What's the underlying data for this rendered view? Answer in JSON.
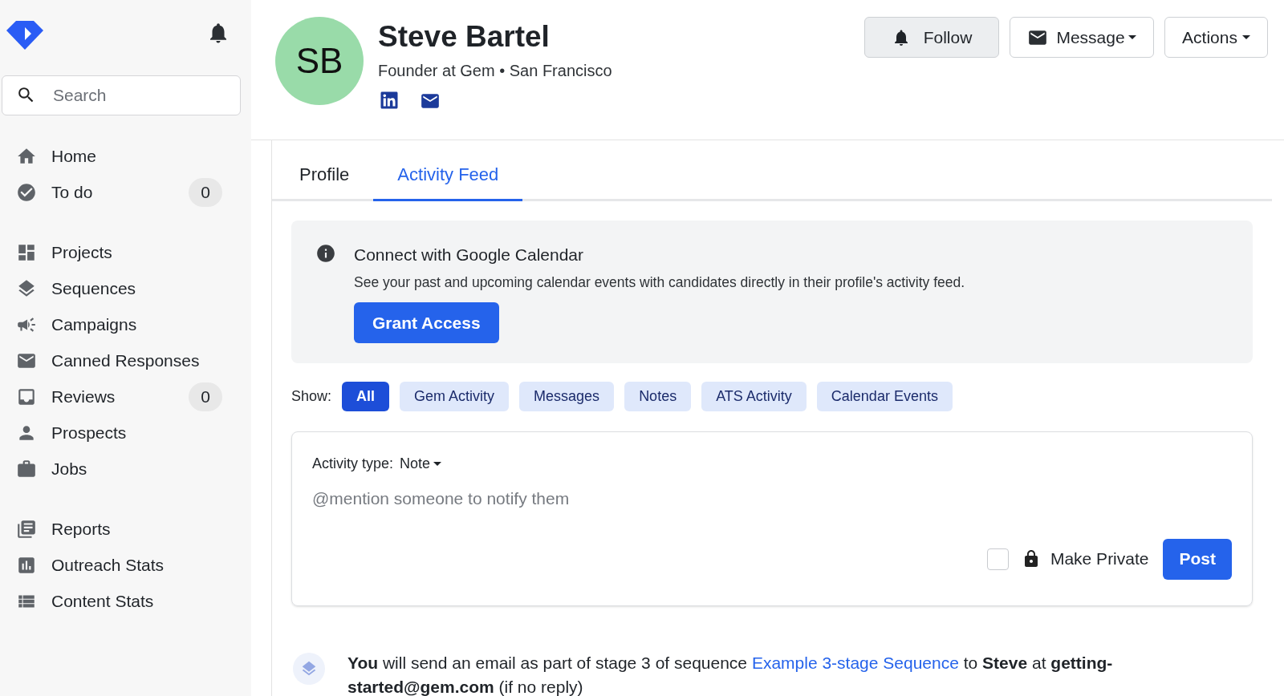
{
  "sidebar": {
    "search": {
      "placeholder": "Search"
    },
    "groups": [
      [
        {
          "label": "Home"
        },
        {
          "label": "To do",
          "count": "0"
        }
      ],
      [
        {
          "label": "Projects"
        },
        {
          "label": "Sequences"
        },
        {
          "label": "Campaigns"
        },
        {
          "label": "Canned Responses"
        },
        {
          "label": "Reviews",
          "count": "0"
        },
        {
          "label": "Prospects"
        },
        {
          "label": "Jobs"
        }
      ],
      [
        {
          "label": "Reports"
        },
        {
          "label": "Outreach Stats"
        },
        {
          "label": "Content Stats"
        }
      ]
    ]
  },
  "profile": {
    "initials": "SB",
    "name": "Steve Bartel",
    "subtitle": "Founder at Gem • San Francisco"
  },
  "actions": [
    {
      "kind": "follow",
      "label": "Follow"
    },
    {
      "kind": "message",
      "label": "Message"
    },
    {
      "kind": "menu",
      "label": "Actions"
    }
  ],
  "tabs": [
    {
      "label": "Profile",
      "selected": false
    },
    {
      "label": "Activity Feed",
      "selected": true
    }
  ],
  "banner": {
    "title": "Connect with Google Calendar",
    "text": "See your past and upcoming calendar events with candidates directly in their profile's activity feed.",
    "button": "Grant Access"
  },
  "filters": {
    "label": "Show:",
    "chips": [
      {
        "label": "All",
        "selected": true
      },
      {
        "label": "Gem Activity",
        "selected": false
      },
      {
        "label": "Messages",
        "selected": false
      },
      {
        "label": "Notes",
        "selected": false
      },
      {
        "label": "ATS Activity",
        "selected": false
      },
      {
        "label": "Calendar Events",
        "selected": false
      }
    ]
  },
  "composer": {
    "type_label": "Activity type:",
    "type_value": "Note",
    "placeholder": "@mention someone to notify them",
    "private": {
      "label": "Make Private",
      "checked": false
    },
    "post": "Post"
  },
  "feed": [
    {
      "before": "**You** will send an email as part of stage 3 of sequence ",
      "link": "Example 3-stage Sequence",
      "after": " to **Steve** at **getting-started@gem.com** (if no reply)"
    }
  ]
}
